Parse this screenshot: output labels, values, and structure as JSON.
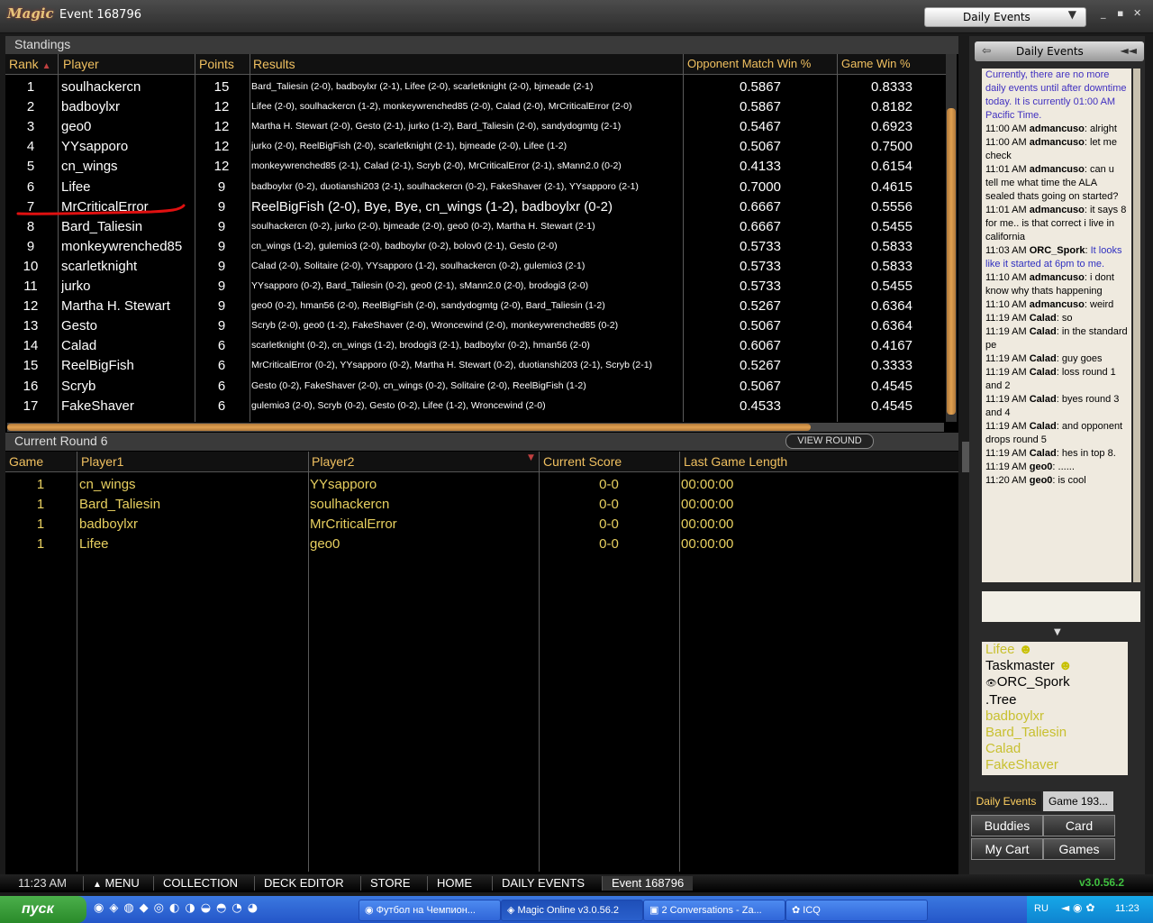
{
  "window": {
    "logo": "Magic",
    "title": "Event 168796",
    "event_selector": "Daily Events",
    "controls": [
      "_",
      "▪",
      "✕"
    ]
  },
  "standings": {
    "section_title": "Standings",
    "headers": {
      "rank": "Rank",
      "player": "Player",
      "points": "Points",
      "results": "Results",
      "omw": "Opponent Match Win %",
      "gw": "Game Win %"
    },
    "rows": [
      {
        "rank": "1",
        "player": "soulhackercn",
        "points": "15",
        "results": "Bard_Taliesin (2-0), badboylxr (2-1), Lifee (2-0), scarletknight (2-0), bjmeade (2-1)",
        "omw": "0.5867",
        "gw": "0.8333"
      },
      {
        "rank": "2",
        "player": "badboylxr",
        "points": "12",
        "results": "Lifee (2-0), soulhackercn (1-2), monkeywrenched85 (2-0), Calad (2-0), MrCriticalError (2-0)",
        "omw": "0.5867",
        "gw": "0.8182"
      },
      {
        "rank": "3",
        "player": "geo0",
        "points": "12",
        "results": "Martha H. Stewart (2-0), Gesto (2-1), jurko (1-2), Bard_Taliesin (2-0), sandydogmtg (2-1)",
        "omw": "0.5467",
        "gw": "0.6923"
      },
      {
        "rank": "4",
        "player": "YYsapporo",
        "points": "12",
        "results": "jurko (2-0), ReelBigFish (2-0), scarletknight (2-1), bjmeade (2-0), Lifee (1-2)",
        "omw": "0.5067",
        "gw": "0.7500"
      },
      {
        "rank": "5",
        "player": "cn_wings",
        "points": "12",
        "results": "monkeywrenched85 (2-1), Calad (2-1), Scryb (2-0), MrCriticalError (2-1), sMann2.0 (0-2)",
        "omw": "0.4133",
        "gw": "0.6154"
      },
      {
        "rank": "6",
        "player": "Lifee",
        "points": "9",
        "results": "badboylxr (0-2), duotianshi203 (2-1), soulhackercn (0-2), FakeShaver (2-1), YYsapporo (2-1)",
        "omw": "0.7000",
        "gw": "0.4615"
      },
      {
        "rank": "7",
        "player": "MrCriticalError",
        "points": "9",
        "results": "ReelBigFish (2-0), Bye, Bye, cn_wings (1-2), badboylxr (0-2)",
        "omw": "0.6667",
        "gw": "0.5556"
      },
      {
        "rank": "8",
        "player": "Bard_Taliesin",
        "points": "9",
        "results": "soulhackercn (0-2), jurko (2-0), bjmeade (2-0), geo0 (0-2), Martha H. Stewart (2-1)",
        "omw": "0.6667",
        "gw": "0.5455"
      },
      {
        "rank": "9",
        "player": "monkeywrenched85",
        "points": "9",
        "results": "cn_wings (1-2), gulemio3 (2-0), badboylxr (0-2), bolov0 (2-1), Gesto (2-0)",
        "omw": "0.5733",
        "gw": "0.5833"
      },
      {
        "rank": "10",
        "player": "scarletknight",
        "points": "9",
        "results": "Calad (2-0), Solitaire (2-0), YYsapporo (1-2), soulhackercn (0-2), gulemio3 (2-1)",
        "omw": "0.5733",
        "gw": "0.5833"
      },
      {
        "rank": "11",
        "player": "jurko",
        "points": "9",
        "results": "YYsapporo (0-2), Bard_Taliesin (0-2), geo0 (2-1), sMann2.0 (2-0), brodogi3 (2-0)",
        "omw": "0.5733",
        "gw": "0.5455"
      },
      {
        "rank": "12",
        "player": "Martha H. Stewart",
        "points": "9",
        "results": "geo0 (0-2), hman56 (2-0), ReelBigFish (2-0), sandydogmtg (2-0), Bard_Taliesin (1-2)",
        "omw": "0.5267",
        "gw": "0.6364"
      },
      {
        "rank": "13",
        "player": "Gesto",
        "points": "9",
        "results": "Scryb (2-0), geo0 (1-2), FakeShaver (2-0), Wroncewind (2-0), monkeywrenched85 (0-2)",
        "omw": "0.5067",
        "gw": "0.6364"
      },
      {
        "rank": "14",
        "player": "Calad",
        "points": "6",
        "results": "scarletknight (0-2), cn_wings (1-2), brodogi3 (2-1), badboylxr (0-2), hman56 (2-0)",
        "omw": "0.6067",
        "gw": "0.4167"
      },
      {
        "rank": "15",
        "player": "ReelBigFish",
        "points": "6",
        "results": "MrCriticalError (0-2), YYsapporo (0-2), Martha H. Stewart (0-2), duotianshi203 (2-1), Scryb (2-1)",
        "omw": "0.5267",
        "gw": "0.3333"
      },
      {
        "rank": "16",
        "player": "Scryb",
        "points": "6",
        "results": "Gesto (0-2), FakeShaver (2-0), cn_wings (0-2), Solitaire (2-0), ReelBigFish (1-2)",
        "omw": "0.5067",
        "gw": "0.4545"
      },
      {
        "rank": "17",
        "player": "FakeShaver",
        "points": "6",
        "results": "gulemio3 (2-0), Scryb (0-2), Gesto (0-2), Lifee (1-2), Wroncewind (2-0)",
        "omw": "0.4533",
        "gw": "0.4545"
      }
    ]
  },
  "current_round": {
    "section_title": "Current Round 6",
    "view_round_label": "VIEW ROUND",
    "headers": {
      "game": "Game",
      "player1": "Player1",
      "player2": "Player2",
      "score": "Current Score",
      "length": "Last Game Length"
    },
    "rows": [
      {
        "game": "1",
        "player1": "cn_wings",
        "player2": "YYsapporo",
        "score": "0-0",
        "length": "00:00:00"
      },
      {
        "game": "1",
        "player1": "Bard_Taliesin",
        "player2": "soulhackercn",
        "score": "0-0",
        "length": "00:00:00"
      },
      {
        "game": "1",
        "player1": "badboylxr",
        "player2": "MrCriticalError",
        "score": "0-0",
        "length": "00:00:00"
      },
      {
        "game": "1",
        "player1": "Lifee",
        "player2": "geo0",
        "score": "0-0",
        "length": "00:00:00"
      }
    ]
  },
  "chat_panel": {
    "title": "Daily Events",
    "messages": [
      {
        "time": "",
        "user": "",
        "text": "Currently, there are no more daily events until after downtime today. It is currently 01:00 AM Pacific Time.",
        "system": true
      },
      {
        "time": "11:00 AM",
        "user": "admancuso",
        "text": "alright"
      },
      {
        "time": "11:00 AM",
        "user": "admancuso",
        "text": "let me check"
      },
      {
        "time": "11:01 AM",
        "user": "admancuso",
        "text": "can u tell me what time the ALA sealed thats going on started?"
      },
      {
        "time": "11:01 AM",
        "user": "admancuso",
        "text": "it says 8 for me.. is that correct i live in california"
      },
      {
        "time": "11:03 AM",
        "user": "ORC_Spork",
        "text": "It looks like it started at 6pm to me.",
        "blue": true
      },
      {
        "time": "11:10 AM",
        "user": "admancuso",
        "text": "i dont know why thats happening"
      },
      {
        "time": "11:10 AM",
        "user": "admancuso",
        "text": "weird"
      },
      {
        "time": "11:19 AM",
        "user": "Calad",
        "text": "so"
      },
      {
        "time": "11:19 AM",
        "user": "Calad",
        "text": "in the standard pe"
      },
      {
        "time": "11:19 AM",
        "user": "Calad",
        "text": "guy goes"
      },
      {
        "time": "11:19 AM",
        "user": "Calad",
        "text": "loss round 1 and 2"
      },
      {
        "time": "11:19 AM",
        "user": "Calad",
        "text": "byes round 3 and 4"
      },
      {
        "time": "11:19 AM",
        "user": "Calad",
        "text": "and opponent drops round 5"
      },
      {
        "time": "11:19 AM",
        "user": "Calad",
        "text": "hes in top 8."
      },
      {
        "time": "11:19 AM",
        "user": "geo0",
        "text": "......"
      },
      {
        "time": "11:20 AM",
        "user": "geo0",
        "text": "is cool"
      }
    ],
    "users": [
      {
        "name": "Lifee",
        "color": "y",
        "icon": "☻"
      },
      {
        "name": "Taskmaster",
        "color": "k",
        "icon": "☻"
      },
      {
        "name": "ORC_Spork",
        "color": "k",
        "icon": "eye"
      },
      {
        "name": ".Tree",
        "color": "k",
        "icon": ""
      },
      {
        "name": "badboylxr",
        "color": "y",
        "icon": ""
      },
      {
        "name": "Bard_Taliesin",
        "color": "y",
        "icon": ""
      },
      {
        "name": "Calad",
        "color": "y",
        "icon": ""
      },
      {
        "name": "FakeShaver",
        "color": "y",
        "icon": ""
      }
    ],
    "tabs": [
      "Daily Events",
      "Game 193..."
    ],
    "buttons": [
      "Buddies",
      "Card",
      "My Cart",
      "Games"
    ]
  },
  "bottom_bar": {
    "time": "11:23 AM",
    "menu": [
      "MENU",
      "COLLECTION",
      "DECK EDITOR",
      "STORE",
      "HOME",
      "DAILY EVENTS",
      "Event 168796"
    ],
    "version": "v3.0.56.2"
  },
  "taskbar": {
    "start": "пуск",
    "items": [
      "Футбол на Чемпион...",
      "Magic Online v3.0.56.2",
      "2 Conversations - Za...",
      "ICQ"
    ],
    "lang": "RU",
    "clock": "11:23"
  },
  "colors": {
    "header_gold": "#f0c060",
    "player_yellow": "#e8d060",
    "chat_blue": "#4030c0",
    "version_green": "#40c040"
  }
}
